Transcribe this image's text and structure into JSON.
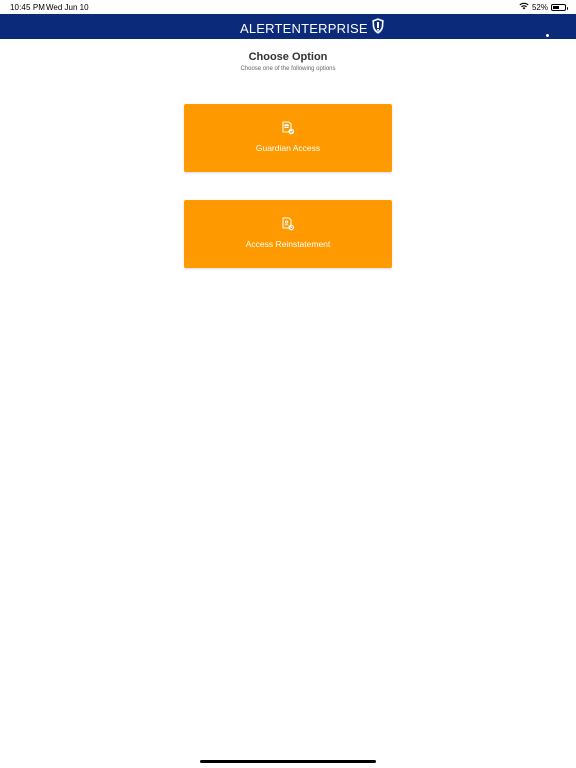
{
  "status_bar": {
    "time": "10:45 PM",
    "date": "Wed Jun 10",
    "battery_percent_label": "52%",
    "battery_level": 0.52,
    "icons": [
      "wifi-icon",
      "battery-icon"
    ]
  },
  "header": {
    "logo_text_1": "Alert",
    "logo_text_2": "Enterprise",
    "logo_icon": "shield-icon",
    "background_color": "#0b2a7a"
  },
  "main": {
    "title": "Choose Option",
    "subtitle": "Choose one of the following options",
    "options": [
      {
        "label": "Guardian Access",
        "icon": "guardian-access-icon"
      },
      {
        "label": "Access Reinstatement",
        "icon": "access-reinstatement-icon"
      }
    ],
    "accent_color": "#ff9900"
  }
}
